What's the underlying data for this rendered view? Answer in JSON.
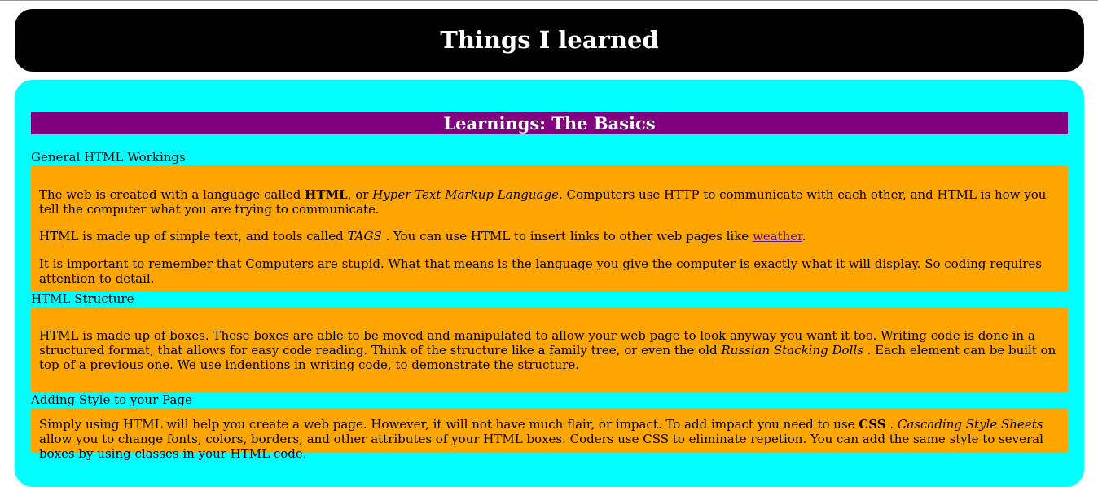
{
  "header": {
    "title": "Things I learned"
  },
  "main": {
    "section_title": "Learnings: The Basics",
    "topics": [
      {
        "title": "General HTML Workings",
        "p1": {
          "a": "The web is created with a language called ",
          "b": "HTML",
          "c": ", or ",
          "d": "Hyper Text Markup Language",
          "e": ". Computers use HTTP to communicate with each other, and HTML is how you tell the computer what you are trying to communicate."
        },
        "p2": {
          "a": "HTML is made up of simple text, and tools called ",
          "b": "TAGS",
          "c": " . You can use HTML to insert links to other web pages like ",
          "link": "weather",
          "d": "."
        },
        "p3": "It is important to remember that Computers are stupid. What that means is the language you give the computer is exactly what it will display. So coding requires attention to detail."
      },
      {
        "title": "HTML Structure",
        "p1": {
          "a": "HTML is made up of boxes. These boxes are able to be moved and manipulated to allow your web page to look anyway you want it too. Writing code is done in a structured format, that allows for easy code reading. Think of the structure like a family tree, or even the old ",
          "b": "Russian Stacking Dolls",
          "c": " . Each element can be built on top of a previous one. We use indentions in writing code, to demonstrate the structure."
        }
      },
      {
        "title": "Adding Style to your Page",
        "p1": {
          "a": "Simply using HTML will help you create a web page. However, it will not have much flair, or impact. To add impact you need to use ",
          "b": "CSS",
          "c": " . ",
          "d": "Cascading Style Sheets",
          "e": " allow you to change fonts, colors, borders, and other attributes of your HTML boxes. Coders use CSS to eliminate repetion. You can add the same style to several boxes by using classes in your HTML code."
        }
      }
    ]
  },
  "colors": {
    "header_bg": "#000000",
    "main_bg": "#00ffff",
    "section_header_bg": "#800080",
    "box_bg": "#ffa500"
  }
}
